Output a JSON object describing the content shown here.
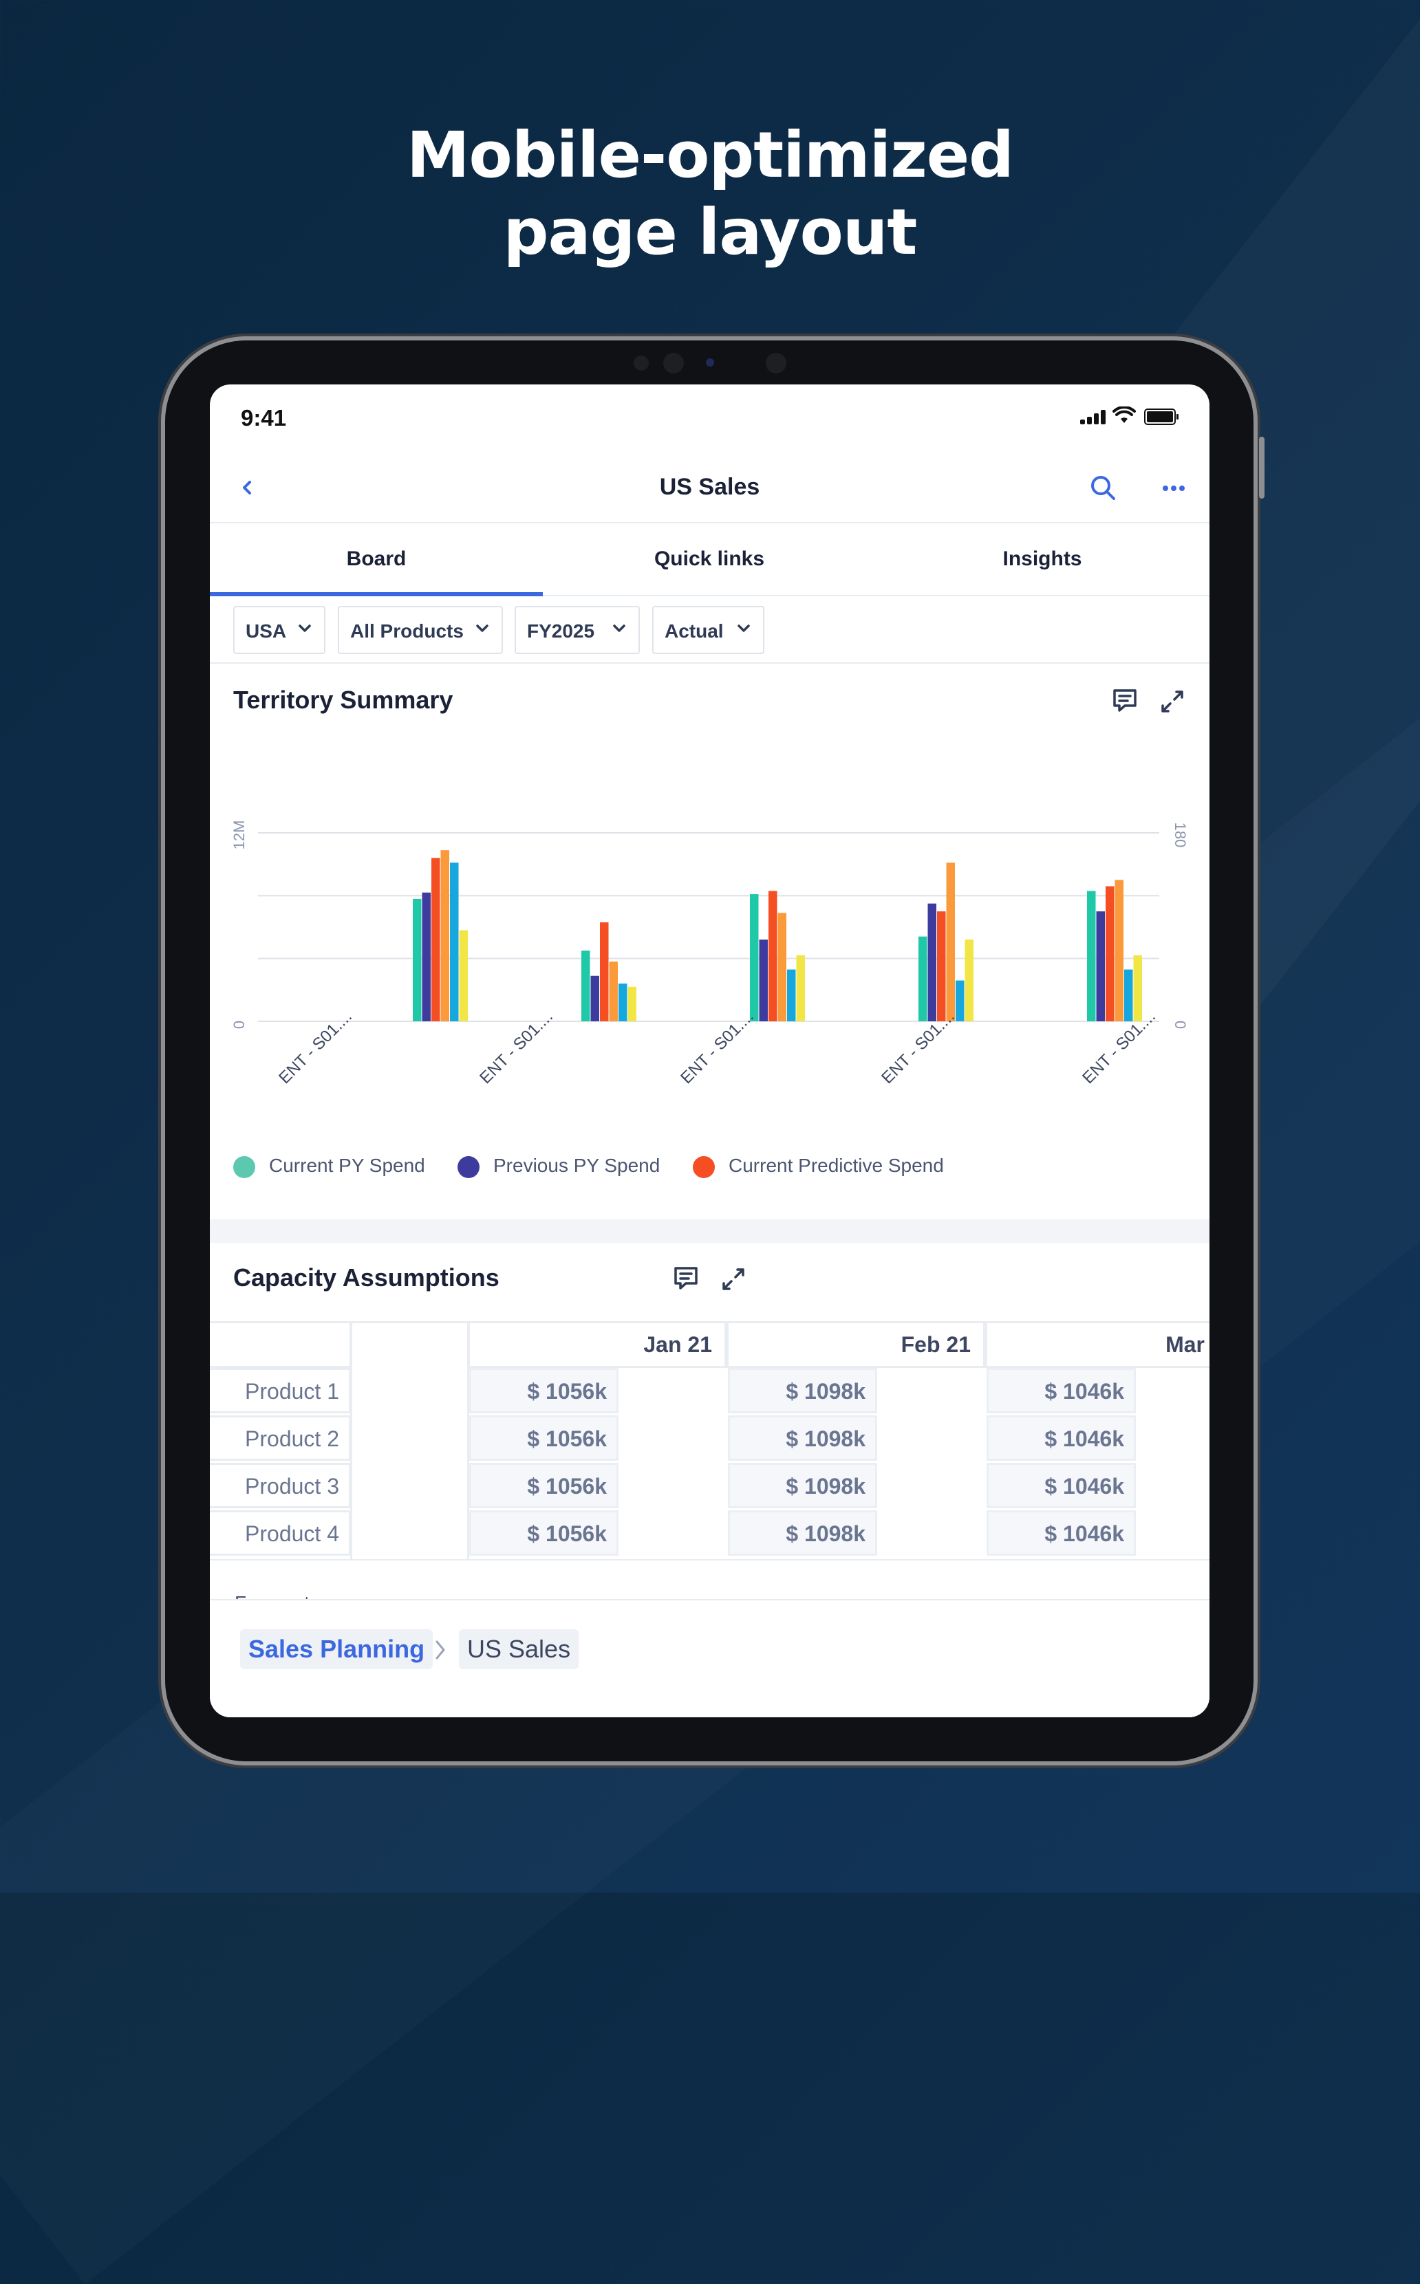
{
  "headline": [
    "Mobile-optimized",
    "page layout"
  ],
  "status_bar": {
    "time": "9:41"
  },
  "nav": {
    "title": "US Sales"
  },
  "tabs": [
    {
      "label": "Board",
      "active": true
    },
    {
      "label": "Quick links",
      "active": false
    },
    {
      "label": "Insights",
      "active": false
    }
  ],
  "filters": [
    {
      "label": "USA"
    },
    {
      "label": "All Products"
    },
    {
      "label": "FY2025"
    },
    {
      "label": "Actual"
    }
  ],
  "territory": {
    "title": "Territory Summary",
    "y_left_ticks": [
      "12M",
      "0"
    ],
    "y_right_ticks": [
      "180",
      "0"
    ]
  },
  "chart_data": {
    "type": "bar",
    "categories": [
      "ENT - S01....",
      "ENT - S01....",
      "ENT - S01....",
      "ENT - S01....",
      "ENT - S01...."
    ],
    "ylim": [
      0,
      12
    ],
    "y_right_lim": [
      0,
      180
    ],
    "grid": true,
    "legend": "bottom-left",
    "series": [
      {
        "name": "Current PY Spend",
        "color": "#1fc9a8",
        "values": [
          7.8,
          4.5,
          8.1,
          5.4,
          8.3
        ]
      },
      {
        "name": "Previous PY Spend",
        "color": "#3d3b9e",
        "values": [
          8.2,
          2.9,
          5.2,
          7.5,
          7.0
        ]
      },
      {
        "name": "Current Predictive Spend",
        "color": "#f44e22",
        "values": [
          10.4,
          6.3,
          8.3,
          7.0,
          8.6
        ]
      },
      {
        "name": "",
        "color": "#fb9a3b",
        "values": [
          10.9,
          3.8,
          6.9,
          10.1,
          9.0
        ]
      },
      {
        "name": "",
        "color": "#16a7df",
        "values": [
          10.1,
          2.4,
          3.3,
          2.6,
          3.3
        ]
      },
      {
        "name": "",
        "color": "#f1e646",
        "values": [
          5.8,
          2.2,
          4.2,
          5.2,
          4.2
        ]
      }
    ]
  },
  "capacity": {
    "title": "Capacity Assumptions",
    "columns": [
      "Jan 21",
      "Feb 21",
      "Mar"
    ],
    "rows": [
      {
        "label": "Product 1",
        "values": [
          "$ 1056k",
          "$ 1098k",
          "$ 1046k"
        ]
      },
      {
        "label": "Product 2",
        "values": [
          "$ 1056k",
          "$ 1098k",
          "$ 1046k"
        ]
      },
      {
        "label": "Product 3",
        "values": [
          "$ 1056k",
          "$ 1098k",
          "$ 1046k"
        ]
      },
      {
        "label": "Product 4",
        "values": [
          "$ 1056k",
          "$ 1098k",
          "$ 1046k"
        ]
      }
    ],
    "next_section_partial": "Forecast"
  },
  "breadcrumb": [
    "Sales Planning",
    "US Sales"
  ],
  "colors": {
    "accent": "#3b67e0",
    "background": "#0f2f4d"
  }
}
